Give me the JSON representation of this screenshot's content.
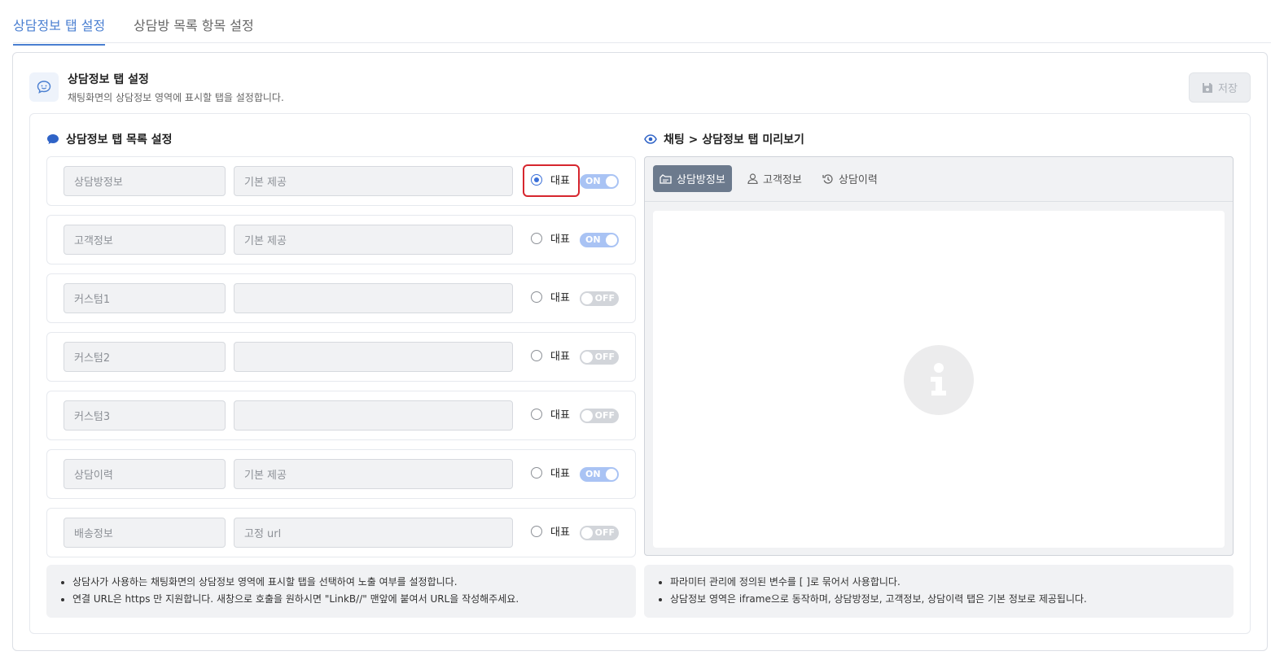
{
  "top_tabs": [
    {
      "label": "상담정보 탭 설정",
      "active": true
    },
    {
      "label": "상담방 목록 항목 설정",
      "active": false
    }
  ],
  "card": {
    "title": "상담정보 탭 설정",
    "description": "채팅화면의 상담정보 영역에 표시할 탭을 설정합니다.",
    "save_label": "저장"
  },
  "left": {
    "title": "상담정보 탭 목록 설정",
    "rep_label": "대표",
    "rows": [
      {
        "name": "상담방정보",
        "desc": "기본 제공",
        "rep": true,
        "state": "ON"
      },
      {
        "name": "고객정보",
        "desc": "기본 제공",
        "rep": false,
        "state": "ON"
      },
      {
        "name": "커스텀1",
        "desc": "",
        "rep": false,
        "state": "OFF"
      },
      {
        "name": "커스텀2",
        "desc": "",
        "rep": false,
        "state": "OFF"
      },
      {
        "name": "커스텀3",
        "desc": "",
        "rep": false,
        "state": "OFF"
      },
      {
        "name": "상담이력",
        "desc": "기본 제공",
        "rep": false,
        "state": "ON"
      },
      {
        "name": "배송정보",
        "desc": "고정 url",
        "rep": false,
        "state": "OFF"
      }
    ],
    "notes": [
      "상담사가 사용하는 채팅화면의 상담정보 영역에 표시할 탭을 선택하여 노출 여부를 설정합니다.",
      "연결 URL은 https 만 지원합니다. 새창으로 호출을 원하시면 \"LinkB//\" 맨앞에 붙여서 URL을 작성해주세요."
    ]
  },
  "right": {
    "title": "채팅 > 상담정보 탭 미리보기",
    "tabs": [
      {
        "label": "상담방정보",
        "active": true
      },
      {
        "label": "고객정보",
        "active": false
      },
      {
        "label": "상담이력",
        "active": false
      }
    ],
    "notes": [
      "파라미터 관리에 정의된 변수를 [ ]로 묶어서 사용합니다.",
      "상담정보 영역은 iframe으로 동작하며, 상담방정보, 고객정보, 상담이력 탭은 기본 정보로 제공됩니다."
    ]
  },
  "colors": {
    "accent": "#4a7fd1",
    "toggle_on": "#a9c3f4",
    "toggle_off": "#d2d5da",
    "highlight": "#d6262e",
    "active_preview_tab": "#6c7a8d"
  }
}
